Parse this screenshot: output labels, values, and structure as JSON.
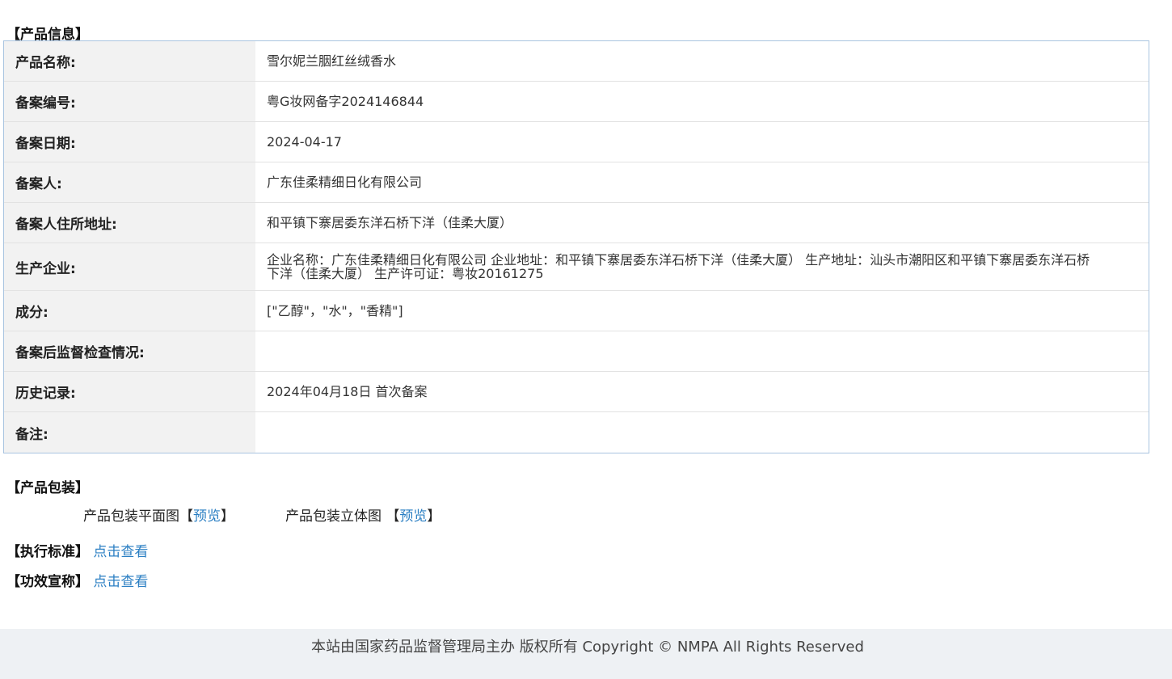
{
  "product_info": {
    "title": "【产品信息】",
    "rows": [
      {
        "label": "产品名称:",
        "value": "雪尔妮兰胭红丝绒香水"
      },
      {
        "label": "备案编号:",
        "value": "粤G妆网备字2024146844"
      },
      {
        "label": "备案日期:",
        "value": "2024-04-17"
      },
      {
        "label": "备案人:",
        "value": "广东佳柔精细日化有限公司"
      },
      {
        "label": "备案人住所地址:",
        "value": "和平镇下寨居委东洋石桥下洋（佳柔大厦）"
      },
      {
        "label": "生产企业:",
        "value": "企业名称：广东佳柔精细日化有限公司 企业地址：和平镇下寨居委东洋石桥下洋（佳柔大厦） 生产地址：汕头市潮阳区和平镇下寨居委东洋石桥下洋（佳柔大厦） 生产许可证：粤妆20161275"
      },
      {
        "label": "成分:",
        "value": "[\"乙醇\"，\"水\"，\"香精\"]"
      },
      {
        "label": "备案后监督检查情况:",
        "value": ""
      },
      {
        "label": "历史记录:",
        "value": "2024年04月18日 首次备案"
      },
      {
        "label": "备注:",
        "value": ""
      }
    ]
  },
  "packaging": {
    "title": "【产品包装】",
    "flat_label": "产品包装平面图",
    "solid_label": "产品包装立体图 ",
    "open_bracket": "【",
    "close_bracket": "】",
    "preview_link": "预览"
  },
  "standard": {
    "title": "【执行标准】",
    "link": "点击查看"
  },
  "efficacy": {
    "title": "【功效宣称】",
    "link": "点击查看"
  },
  "footer": {
    "text": "本站由国家药品监督管理局主办 版权所有 Copyright © NMPA All Rights Reserved"
  }
}
